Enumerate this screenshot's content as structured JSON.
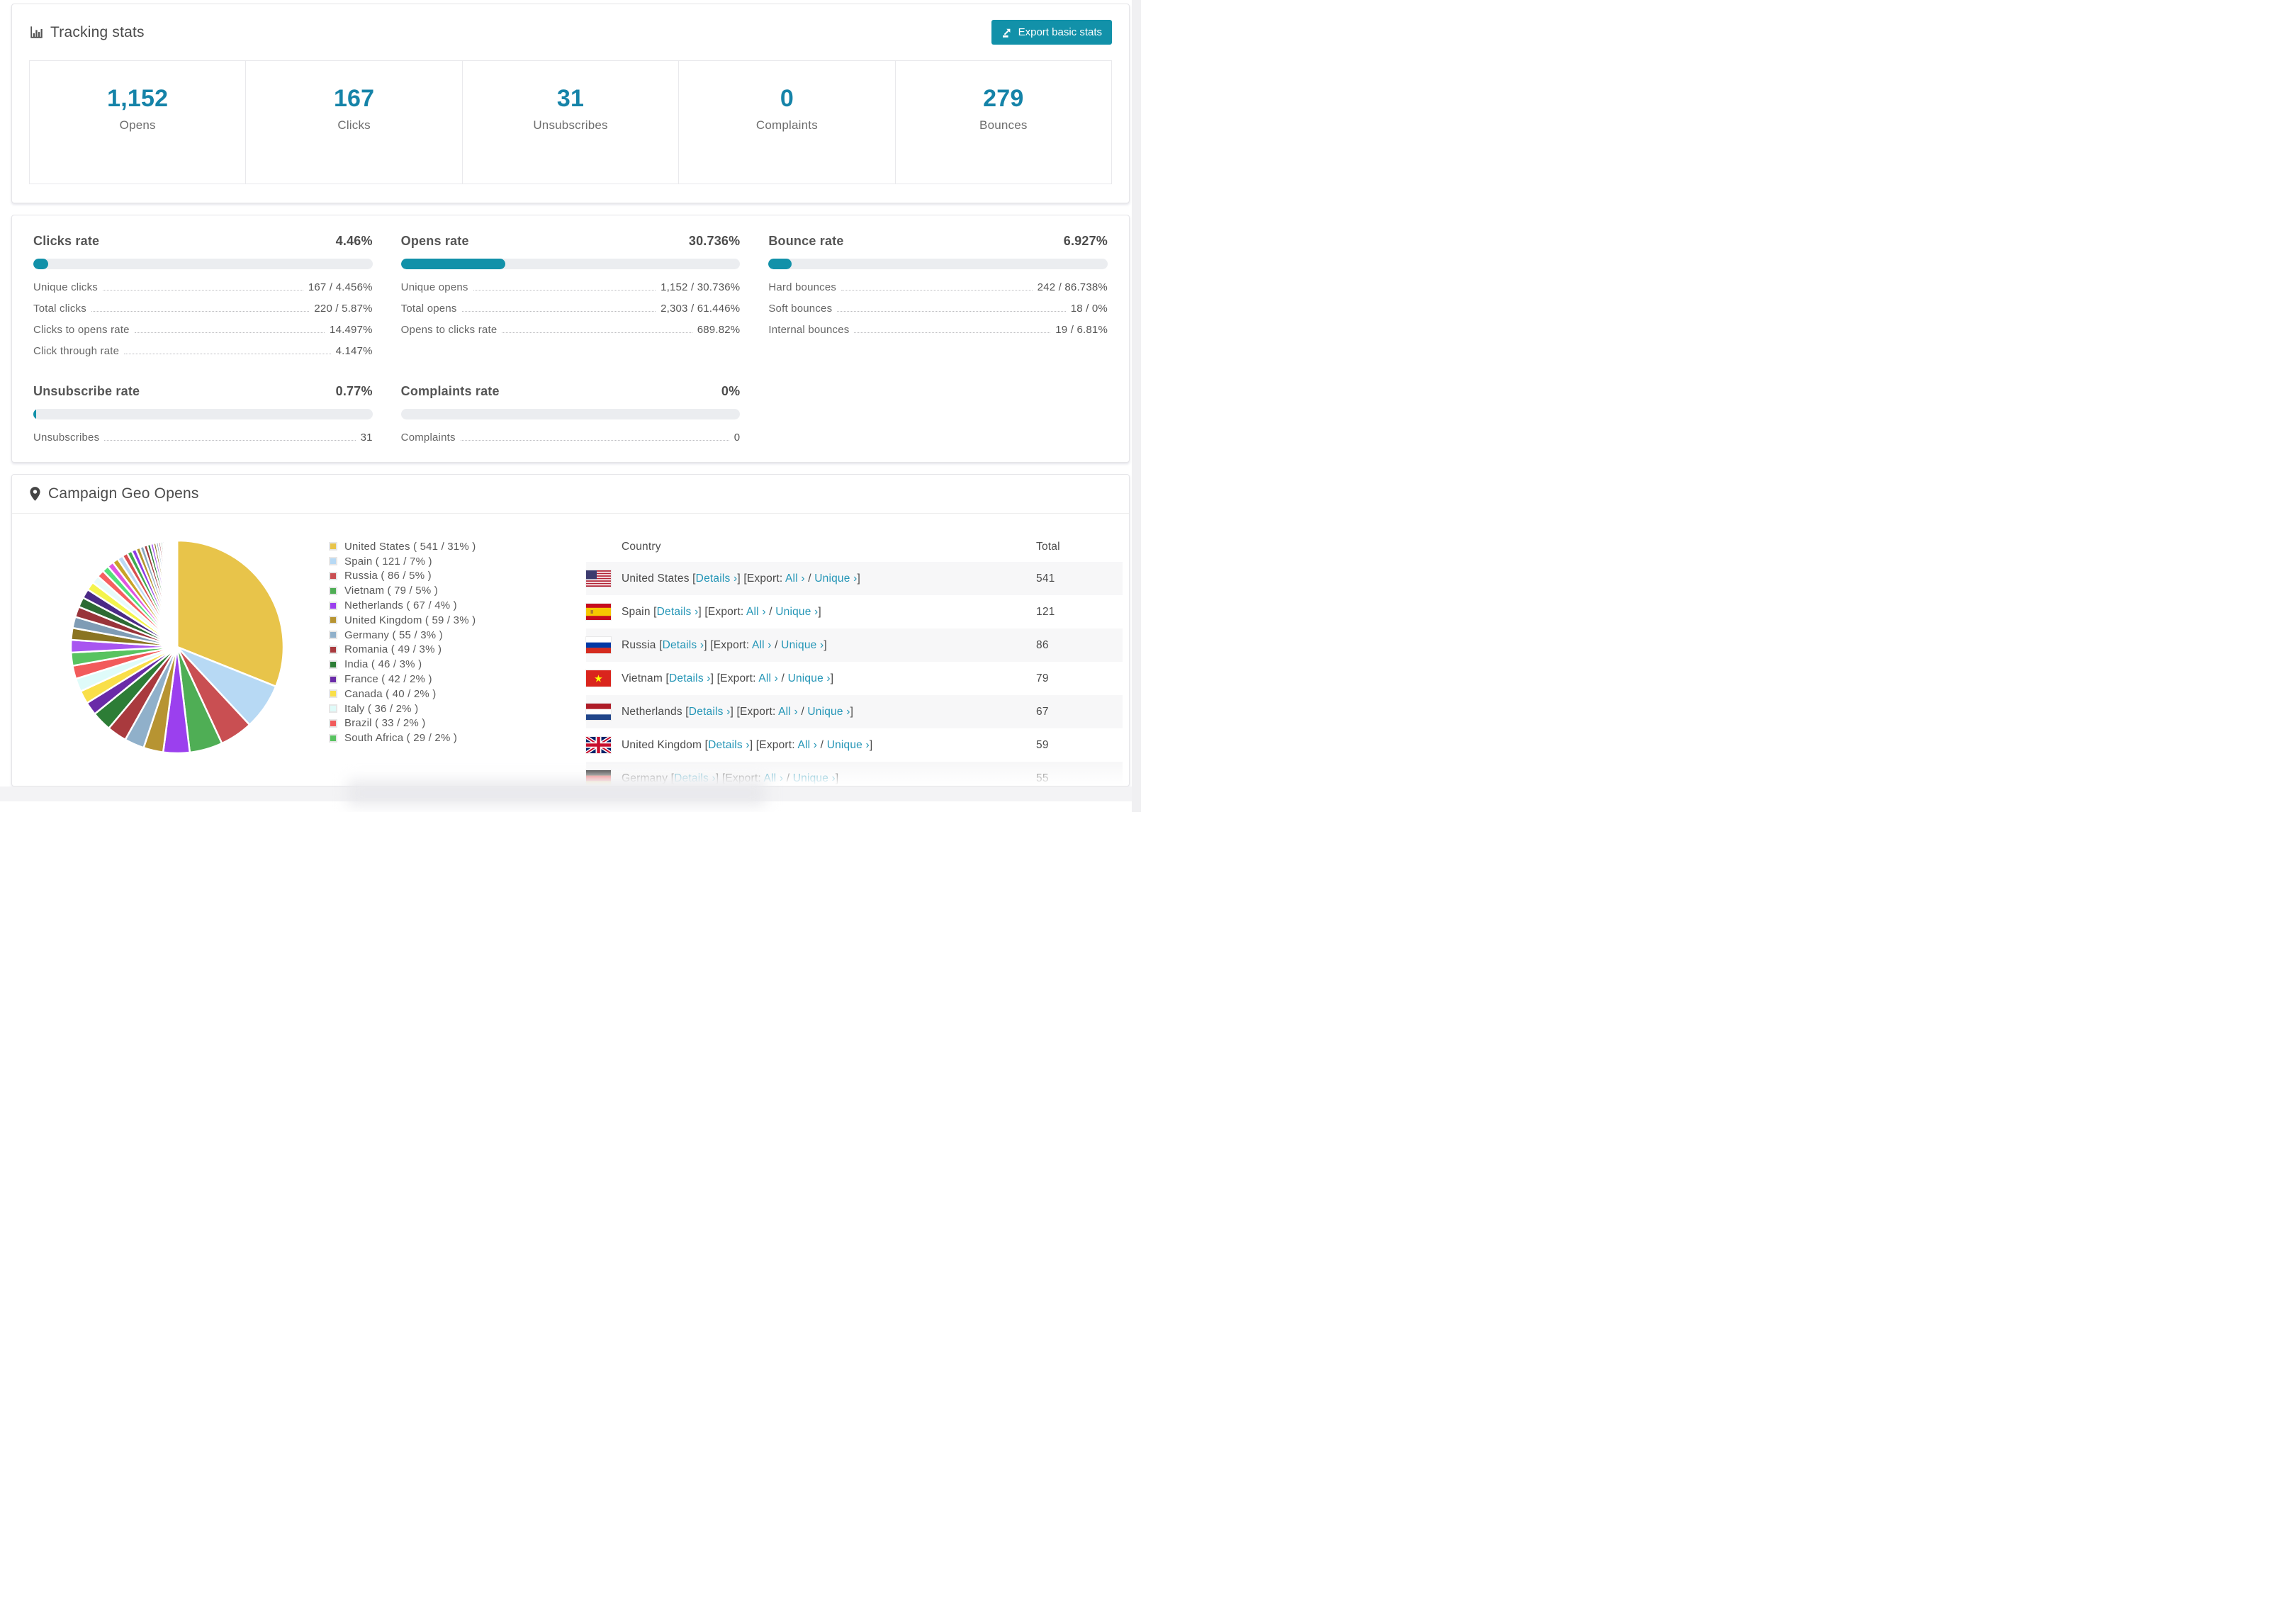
{
  "colors": {
    "accent_teal": "#1291a9",
    "number_teal": "#1583a8",
    "link_teal": "#2395b6",
    "bar_bg": "#ebedf0",
    "row_stripe": "#f7f7f8"
  },
  "tracking": {
    "title": "Tracking stats",
    "export_label": "Export basic stats",
    "stats": [
      {
        "value": "1,152",
        "label": "Opens"
      },
      {
        "value": "167",
        "label": "Clicks"
      },
      {
        "value": "31",
        "label": "Unsubscribes"
      },
      {
        "value": "0",
        "label": "Complaints"
      },
      {
        "value": "279",
        "label": "Bounces"
      }
    ]
  },
  "rates": {
    "panels": [
      {
        "title": "Clicks rate",
        "value": "4.46%",
        "percent": 4.46,
        "rows": [
          {
            "label": "Unique clicks",
            "value": "167 / 4.456%"
          },
          {
            "label": "Total clicks",
            "value": "220 / 5.87%"
          },
          {
            "label": "Clicks to opens rate",
            "value": "14.497%"
          },
          {
            "label": "Click through rate",
            "value": "4.147%"
          }
        ]
      },
      {
        "title": "Opens rate",
        "value": "30.736%",
        "percent": 30.736,
        "rows": [
          {
            "label": "Unique opens",
            "value": "1,152 / 30.736%"
          },
          {
            "label": "Total opens",
            "value": "2,303 / 61.446%"
          },
          {
            "label": "Opens to clicks rate",
            "value": "689.82%"
          }
        ]
      },
      {
        "title": "Bounce rate",
        "value": "6.927%",
        "percent": 6.927,
        "rows": [
          {
            "label": "Hard bounces",
            "value": "242 / 86.738%"
          },
          {
            "label": "Soft bounces",
            "value": "18 / 0%"
          },
          {
            "label": "Internal bounces",
            "value": "19 / 6.81%"
          }
        ]
      },
      {
        "title": "Unsubscribe rate",
        "value": "0.77%",
        "percent": 0.77,
        "rows": [
          {
            "label": "Unsubscribes",
            "value": "31"
          }
        ]
      },
      {
        "title": "Complaints rate",
        "value": "0%",
        "percent": 0,
        "rows": [
          {
            "label": "Complaints",
            "value": "0"
          }
        ]
      }
    ]
  },
  "geo": {
    "title": "Campaign Geo Opens",
    "table": {
      "country_header": "Country",
      "total_header": "Total",
      "details_label": "Details",
      "export_prefix": "Export:",
      "all_label": "All",
      "unique_label": "Unique",
      "arrow": "›",
      "rows": [
        {
          "country": "United States",
          "flag": "us",
          "total": "541"
        },
        {
          "country": "Spain",
          "flag": "es",
          "total": "121"
        },
        {
          "country": "Russia",
          "flag": "ru",
          "total": "86"
        },
        {
          "country": "Vietnam",
          "flag": "vn",
          "total": "79"
        },
        {
          "country": "Netherlands",
          "flag": "nl",
          "total": "67"
        },
        {
          "country": "United Kingdom",
          "flag": "gb",
          "total": "59"
        },
        {
          "country": "Germany",
          "flag": "de",
          "total": "55",
          "partial": true
        }
      ]
    }
  },
  "chart_data": {
    "type": "pie",
    "title": "Campaign Geo Opens",
    "unit": "opens",
    "legend_position": "right",
    "start_angle_deg": -90,
    "direction": "clockwise",
    "slices": [
      {
        "label": "United States",
        "count": 541,
        "pct": 31,
        "color": "#e8c44a"
      },
      {
        "label": "Spain",
        "count": 121,
        "pct": 7,
        "color": "#b7d9f4"
      },
      {
        "label": "Russia",
        "count": 86,
        "pct": 5,
        "color": "#c94f52"
      },
      {
        "label": "Vietnam",
        "count": 79,
        "pct": 5,
        "color": "#4fae55"
      },
      {
        "label": "Netherlands",
        "count": 67,
        "pct": 4,
        "color": "#9b40ee"
      },
      {
        "label": "United Kingdom",
        "count": 59,
        "pct": 3,
        "color": "#b79432"
      },
      {
        "label": "Germany",
        "count": 55,
        "pct": 3,
        "color": "#90b0ca"
      },
      {
        "label": "Romania",
        "count": 49,
        "pct": 3,
        "color": "#a93a3e"
      },
      {
        "label": "India",
        "count": 46,
        "pct": 3,
        "color": "#2d7d36"
      },
      {
        "label": "France",
        "count": 42,
        "pct": 2,
        "color": "#6a2ba8"
      },
      {
        "label": "Canada",
        "count": 40,
        "pct": 2,
        "color": "#f9df49"
      },
      {
        "label": "Italy",
        "count": 36,
        "pct": 2,
        "color": "#dffbf9"
      },
      {
        "label": "Brazil",
        "count": 33,
        "pct": 2,
        "color": "#f25b5b"
      },
      {
        "label": "South Africa",
        "count": 29,
        "pct": 2,
        "color": "#58c360"
      }
    ],
    "tail_slices_pct": [
      1.9,
      1.8,
      1.7,
      1.6,
      1.5,
      1.4,
      1.3,
      1.2,
      1.1,
      1.0,
      0.95,
      0.9,
      0.85,
      0.8,
      0.75,
      0.7,
      0.65,
      0.6,
      0.55,
      0.5,
      0.45,
      0.4,
      0.36,
      0.33,
      0.3,
      0.27,
      0.24,
      0.21,
      0.19,
      0.17,
      0.15,
      0.13,
      0.11,
      0.1,
      0.09,
      0.08,
      0.07,
      0.06,
      0.05,
      0.05,
      0.04,
      0.04,
      0.03,
      0.03,
      0.02,
      0.02,
      0.02,
      0.01,
      0.01,
      0.01
    ],
    "tail_palette": [
      "#a855f0",
      "#8a7422",
      "#7f9cb5",
      "#99343a",
      "#2d6b33",
      "#4b2a86",
      "#f4f44c",
      "#e8fbfa",
      "#f66060",
      "#52e07a",
      "#e055e0",
      "#c9a227",
      "#bcd9f2",
      "#d94f4f",
      "#3faa4f",
      "#8f3be4",
      "#b5952f",
      "#8aa9c0",
      "#a03a3c",
      "#2d7d36"
    ]
  }
}
